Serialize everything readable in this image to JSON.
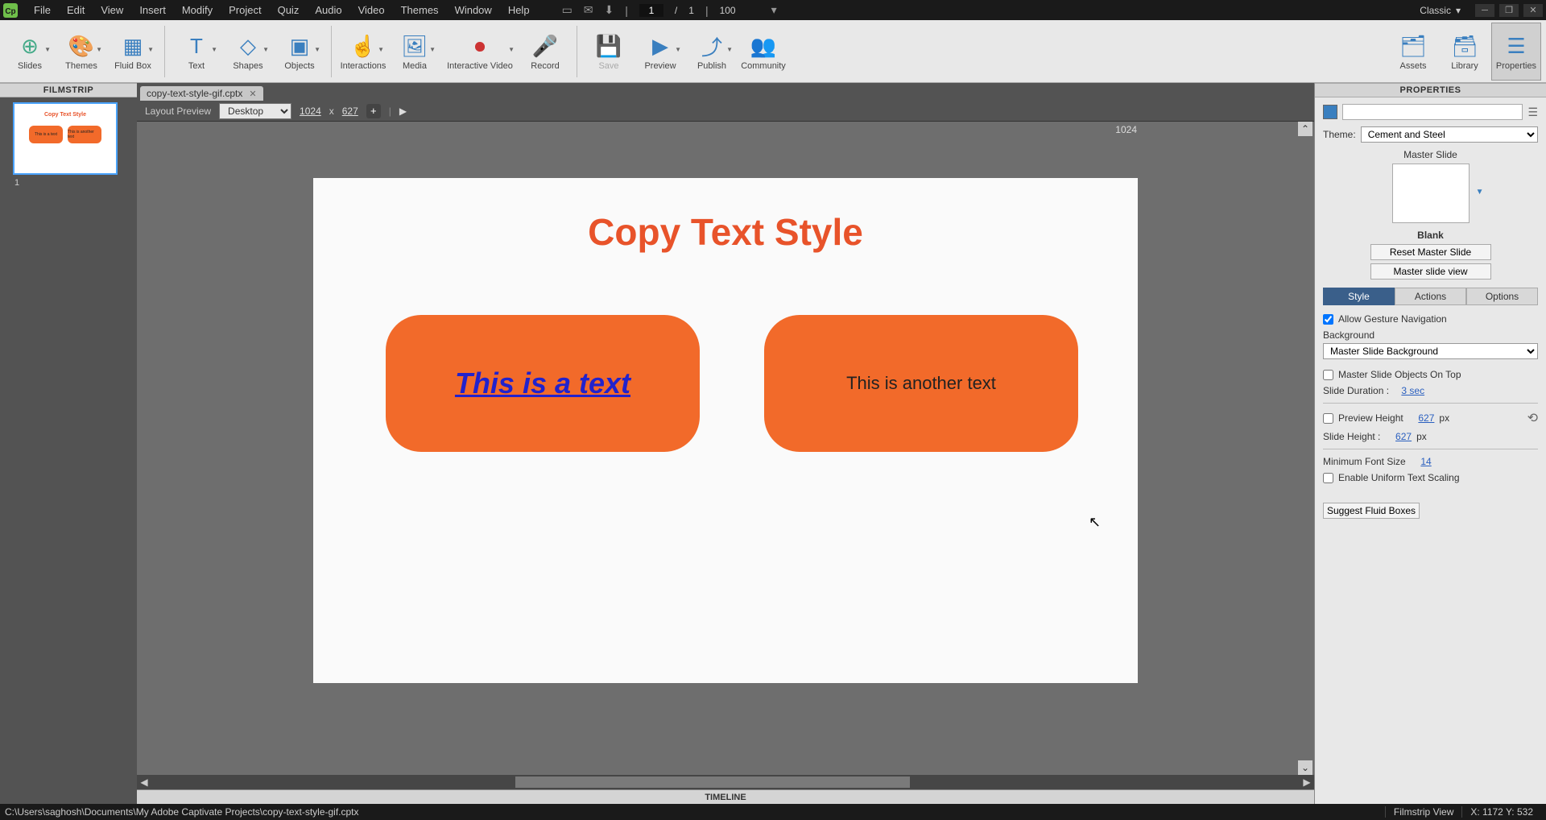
{
  "menus": [
    "File",
    "Edit",
    "View",
    "Insert",
    "Modify",
    "Project",
    "Quiz",
    "Audio",
    "Video",
    "Themes",
    "Window",
    "Help"
  ],
  "workspace": "Classic",
  "page": {
    "current": "1",
    "sep": "/",
    "total": "1",
    "zoom": "100"
  },
  "ribbon": {
    "slides": "Slides",
    "themes": "Themes",
    "fluidbox": "Fluid Box",
    "text": "Text",
    "shapes": "Shapes",
    "objects": "Objects",
    "interactions": "Interactions",
    "media": "Media",
    "ivideo": "Interactive Video",
    "record": "Record",
    "save": "Save",
    "preview": "Preview",
    "publish": "Publish",
    "community": "Community",
    "assets": "Assets",
    "library": "Library",
    "properties": "Properties"
  },
  "panels": {
    "filmstrip": "FILMSTRIP",
    "properties": "PROPERTIES",
    "timeline": "TIMELINE"
  },
  "doc": {
    "tab": "copy-text-style-gif.cptx"
  },
  "stage": {
    "layout_preview": "Layout Preview",
    "device": "Desktop",
    "w": "1024",
    "x": "x",
    "h": "627",
    "ruler": "1024"
  },
  "slide": {
    "title": "Copy Text Style",
    "text1": "This is a text",
    "text2": "This is another text",
    "index": "1"
  },
  "props": {
    "theme_label": "Theme:",
    "theme_value": "Cement and Steel",
    "master_slide": "Master Slide",
    "master_name": "Blank",
    "reset_master": "Reset Master Slide",
    "master_view": "Master slide view",
    "tab_style": "Style",
    "tab_actions": "Actions",
    "tab_options": "Options",
    "allow_gesture": "Allow Gesture Navigation",
    "background": "Background",
    "bg_value": "Master Slide Background",
    "objects_on_top": "Master Slide Objects On Top",
    "slide_duration_label": "Slide Duration :",
    "slide_duration_val": "3 sec",
    "preview_height": "Preview Height",
    "preview_h_val": "627",
    "px": "px",
    "slide_height_label": "Slide Height :",
    "slide_h_val": "627",
    "min_font": "Minimum Font Size",
    "min_font_val": "14",
    "uniform_scaling": "Enable Uniform Text Scaling",
    "suggest": "Suggest Fluid Boxes"
  },
  "status": {
    "path": "C:\\Users\\saghosh\\Documents\\My Adobe Captivate Projects\\copy-text-style-gif.cptx",
    "view": "Filmstrip View",
    "coords": "X: 1172 Y: 532"
  }
}
